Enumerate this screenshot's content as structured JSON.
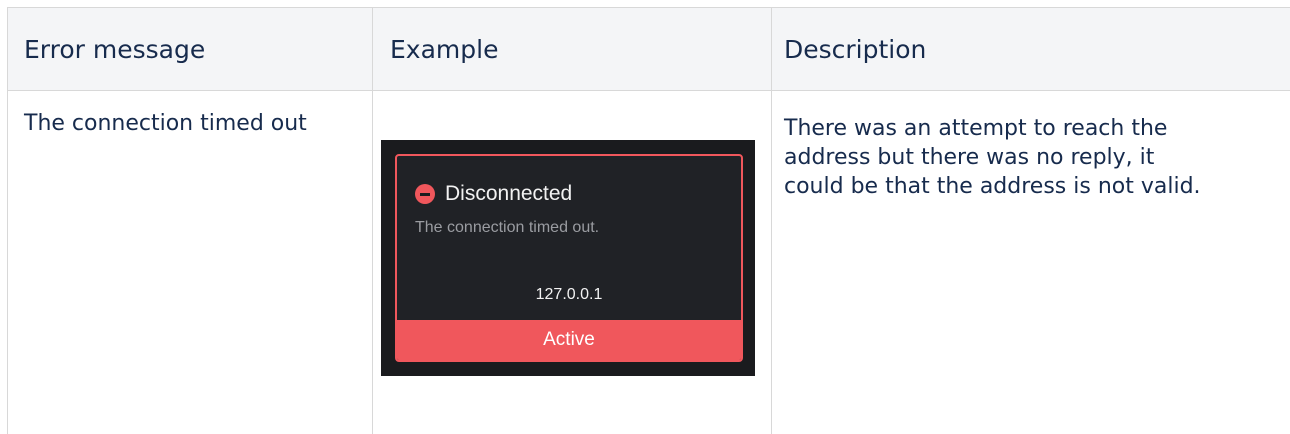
{
  "table": {
    "headers": [
      "Error message",
      "Example",
      "Description"
    ],
    "rows": [
      {
        "error_message": "The connection timed out",
        "description_lines": [
          "There was an attempt to reach the",
          "address but there was no reply, it",
          "could be that the address is not valid."
        ],
        "example": {
          "status_label": "Disconnected",
          "status_icon": "minus-circle-icon",
          "message": "The connection timed out.",
          "address": "127.0.0.1",
          "state_label": "Active",
          "colors": {
            "accent": "#f0575c",
            "card_background": "#202226"
          }
        }
      }
    ]
  }
}
